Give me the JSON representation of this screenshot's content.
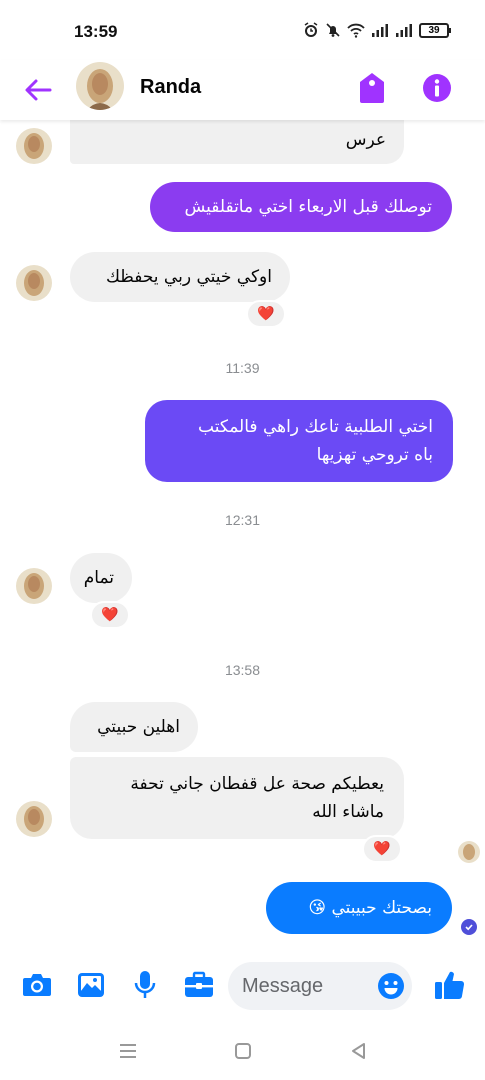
{
  "status_bar": {
    "time": "13:59",
    "battery": "39",
    "icons": [
      "alarm-icon",
      "mute-icon",
      "wifi-icon",
      "signal-icon",
      "signal-icon",
      "battery-icon"
    ]
  },
  "header": {
    "contact_name": "Randa",
    "back_icon": "arrow-left-icon",
    "tag_icon": "tag-icon",
    "info_icon": "info-icon"
  },
  "colors": {
    "accent": "#a033ff",
    "outgoing_purple": "#8b3cf0",
    "outgoing_indigo": "#6b4af5",
    "outgoing_blue": "#0a7cff",
    "incoming_bg": "#f0f0f0",
    "timestamp": "#8a8d91",
    "composer_icons": "#0a7cff",
    "heart": "#e41e3f"
  },
  "messages": [
    {
      "side": "incoming",
      "text": "عرس"
    },
    {
      "side": "outgoing",
      "text": "توصلك قبل الاربعاء اختي ماتقلقيش"
    },
    {
      "side": "incoming",
      "text": "اوكي خيتي ربي يحفظك",
      "reaction": "❤️"
    },
    {
      "type": "timestamp",
      "text": "11:39"
    },
    {
      "side": "outgoing",
      "text": "اختي الطلبية تاعك راهي فالمكتب\nباه تروحي تهزيها"
    },
    {
      "type": "timestamp",
      "text": "12:31"
    },
    {
      "side": "incoming",
      "text": "تمام",
      "reaction": "❤️"
    },
    {
      "type": "timestamp",
      "text": "13:58"
    },
    {
      "side": "incoming",
      "text": "اهلين حبيتي"
    },
    {
      "side": "incoming",
      "text": "يعطيكم صحة عل قفطان جاني تحفة\nماشاء الله",
      "reaction": "❤️"
    },
    {
      "side": "outgoing",
      "text": "بصحتك حبيبتي 😘"
    }
  ],
  "composer": {
    "placeholder": "Message",
    "icons": [
      "camera-icon",
      "image-icon",
      "microphone-icon",
      "briefcase-icon",
      "emoji-icon",
      "thumbs-up-icon"
    ]
  },
  "nav_bar": {
    "icons": [
      "menu-icon",
      "home-square-icon",
      "back-triangle-icon"
    ]
  }
}
